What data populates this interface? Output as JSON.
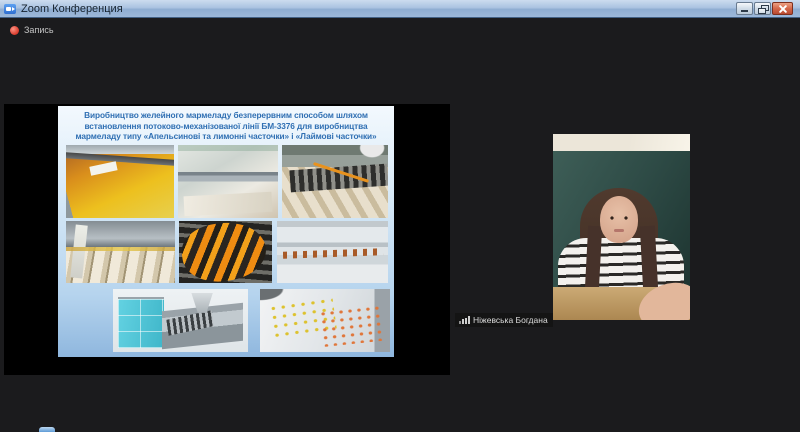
{
  "window": {
    "title": "Zoom Конференция",
    "controls": {
      "minimize": "minimize",
      "restore": "restore",
      "close": "close"
    }
  },
  "meeting": {
    "recording_label": "Запись"
  },
  "shared_slide": {
    "title_lines": [
      "Виробництво желейного мармеладу безперервним способом шляхом",
      "встановлення потоково-механізованої лінії БМ-3376 для виробництва",
      "мармеладу типу «Апельсинові та лимонні часточки» і «Лаймові часточки»"
    ],
    "photos": [
      "marmalade-casting-tray",
      "forming-conveyor-machine",
      "cutting-discs-machine",
      "roller-conveyor",
      "orange-striped-drum",
      "marmalade-pieces-line",
      "teal-cabinet-hopper-machine",
      "marmalade-slices-on-belt"
    ]
  },
  "participant": {
    "name": "Ніжевська Богдана"
  },
  "colors": {
    "titlebar": "#a9c2e0",
    "window_bg": "#1b1b1d",
    "share_bg": "#000000",
    "slide_top": "#f3f9fe",
    "slide_bottom": "#8fb7de",
    "slide_title_text": "#2f6fb3",
    "record_dot": "#d83a2b",
    "close_button": "#c65540",
    "cabinet_teal": "#4fc4d6"
  }
}
